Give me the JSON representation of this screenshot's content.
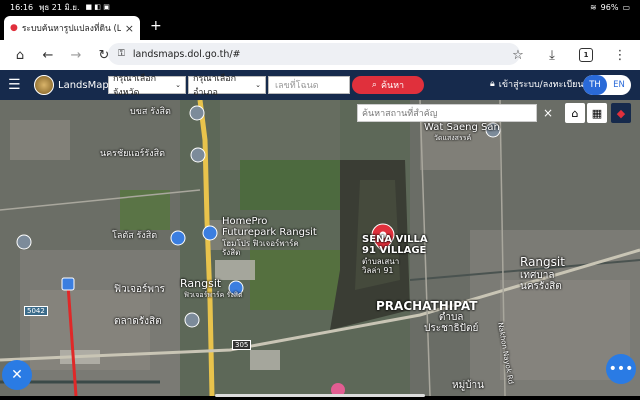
{
  "status_bar": {
    "time": "16:16",
    "date": "พุธ 21 มิ.ย.",
    "battery": "96%"
  },
  "browser": {
    "tab_title": "ระบบค้นหารูปแปลงที่ดิน (Land",
    "url": "landsmaps.dol.go.th/#",
    "tab_count": "1"
  },
  "appbar": {
    "brand": "LandsMaps",
    "province_select": "กรุณาเลือกจังหวัด",
    "district_select": "กรุณาเลือกอำเภอ",
    "parcel_placeholder": "เลขที่โฉนด",
    "search_button": "ค้นหา",
    "login_label": "เข้าสู่ระบบ/ลงทะเบียน",
    "lang_th": "TH",
    "lang_en": "EN"
  },
  "map": {
    "place_search_placeholder": "ค้นหาสถานที่สำคัญ",
    "labels": {
      "wat_en": "Wat Saeng San",
      "wat_th": "วัดแสงสรรค์",
      "bus_stop": "บขส รังสิต",
      "airforce": "นครชัยแอร์รังสิต",
      "homepro_en": "HomePro\nFuturepark Rangsit",
      "homepro_th": "โฮมโปร ฟิวเจอร์พาร์ครังสิต",
      "lotus": "โลตัส รังสิต",
      "rangsit_mid": "Rangsit",
      "rangsit_mid_th": "ฟิวเจอร์พาร์ค รังสิต",
      "future": "ฟิวเจอร์พาร",
      "market": "ตลาดรังสิต",
      "sena_en": "SENA VILLA\n91 VILLAGE",
      "sena_th": "ตำบลเสนา\nวิลล่า 91",
      "rangsit_right": "Rangsit",
      "rangsit_right_th": "เทศบาล\nนครรังสิต",
      "prachathipat_en": "PRACHATHIPAT",
      "prachathipat_th": "ตำบล\nประชาธิปัตย์",
      "village": "หมู่บ้าน",
      "nakhon_nayok": "Nakhon Nayok Rd",
      "road_305": "305",
      "road_5042": "5042"
    }
  },
  "colors": {
    "appbar": "#162a4c",
    "search_button": "#e0303c",
    "fab": "#2a7be4",
    "map_pin": "#e0303c"
  }
}
